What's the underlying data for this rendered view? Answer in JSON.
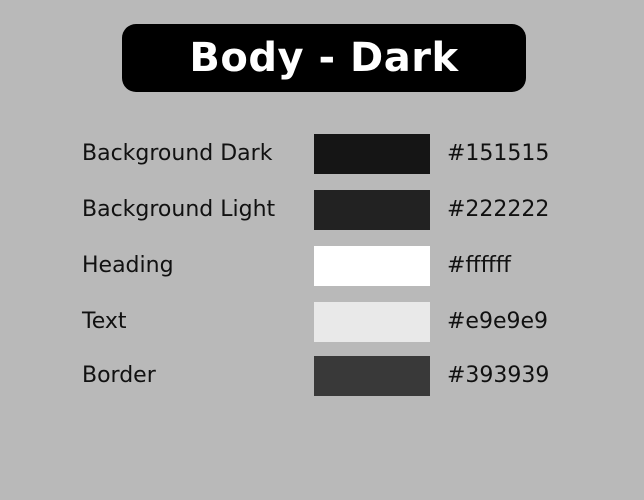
{
  "title": "Body - Dark",
  "swatches": [
    {
      "label": "Background Dark",
      "hex": "#151515",
      "color": "#151515"
    },
    {
      "label": "Background Light",
      "hex": "#222222",
      "color": "#222222"
    },
    {
      "label": "Heading",
      "hex": "#ffffff",
      "color": "#ffffff"
    },
    {
      "label": "Text",
      "hex": "#e9e9e9",
      "color": "#e9e9e9"
    },
    {
      "label": "Border",
      "hex": "#393939",
      "color": "#393939"
    }
  ],
  "colors": {
    "page_background": "#b9b9b9",
    "title_background": "#000000",
    "title_text": "#ffffff"
  }
}
